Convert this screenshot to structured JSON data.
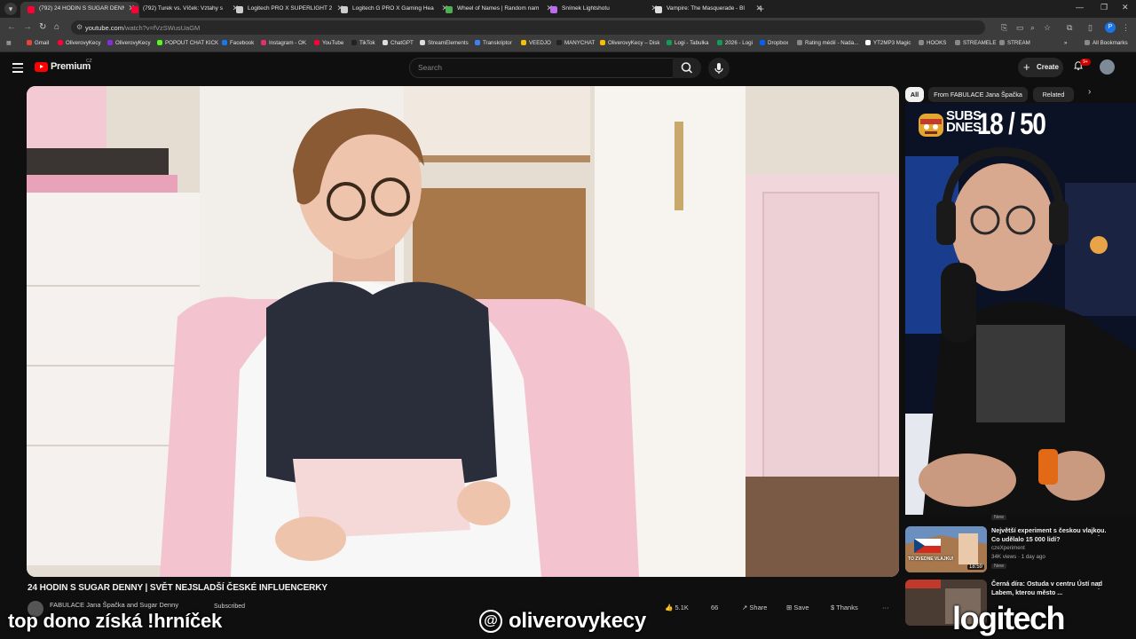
{
  "browser": {
    "tabs": [
      {
        "title": "(792) 24 HODIN S SUGAR DENNY",
        "active": true,
        "favicon_color": "#ff0033"
      },
      {
        "title": "(792) Turek vs. Víček: Vztahy s",
        "active": false,
        "favicon_color": "#ff0033"
      },
      {
        "title": "Logitech PRO X SUPERLIGHT 2",
        "active": false,
        "favicon_color": "#cccccc"
      },
      {
        "title": "Logitech G PRO X Gaming Hea",
        "active": false,
        "favicon_color": "#cccccc"
      },
      {
        "title": "Wheel of Names | Random nam",
        "active": false,
        "favicon_color": "#4caf50"
      },
      {
        "title": "Snímek Lightshotu",
        "active": false,
        "favicon_color": "#b96cf0"
      },
      {
        "title": "Vampire: The Masquerade - Bl",
        "active": false,
        "favicon_color": "#dddddd"
      }
    ],
    "url_host": "youtube.com",
    "url_path": "/watch?v=fVzSWusUaGM",
    "profile_initial": "P",
    "bookmarks": [
      {
        "label": "Gmail",
        "color": "#ea4335"
      },
      {
        "label": "OliverovyKecy",
        "color": "#ff0033"
      },
      {
        "label": "OliverovyKecy",
        "color": "#8a2be2"
      },
      {
        "label": "POPOUT CHAT KICK",
        "color": "#53fc18"
      },
      {
        "label": "Facebook",
        "color": "#1877f2"
      },
      {
        "label": "Instagram - OK",
        "color": "#e1306c"
      },
      {
        "label": "YouTube",
        "color": "#ff0033"
      },
      {
        "label": "TikTok",
        "color": "#222222"
      },
      {
        "label": "ChatGPT",
        "color": "#dddddd"
      },
      {
        "label": "StreamElements",
        "color": "#dddddd"
      },
      {
        "label": "Transkriptor",
        "color": "#3b82f6"
      },
      {
        "label": "VEEDJO",
        "color": "#f5c400"
      },
      {
        "label": "MANYCHAT",
        "color": "#222222"
      },
      {
        "label": "OliverovyKecy – Disk",
        "color": "#fbbc04"
      },
      {
        "label": "Logi - Tabulka",
        "color": "#0f9d58"
      },
      {
        "label": "2026 - Logi",
        "color": "#0f9d58"
      },
      {
        "label": "Dropbox",
        "color": "#0061ff"
      },
      {
        "label": "Rating médií - Nada...",
        "color": "#888888"
      },
      {
        "label": "YT2MP3 Magic",
        "color": "#ffffff"
      },
      {
        "label": "HOOKS",
        "color": "#888888"
      },
      {
        "label": "STREAMELE",
        "color": "#888888"
      },
      {
        "label": "STREAM",
        "color": "#888888"
      }
    ],
    "all_bookmarks_label": "All Bookmarks"
  },
  "youtube": {
    "logo_text": "Premium",
    "country_code": "CZ",
    "search_placeholder": "Search",
    "create_label": "Create",
    "notification_count": "9+",
    "video_title": "24 HODIN S SUGAR DENNY | SVĚT NEJSLADŠÍ ČESKÉ INFLUENCERKY",
    "channel_name": "FABULACE Jana Špačka and Sugar Denny",
    "subscribed_label": "Subscribed",
    "like_count": "5.1K",
    "dislike_count": "66",
    "share_label": "Share",
    "save_label": "Save",
    "thanks_label": "Thanks",
    "more_label": "···",
    "chips": [
      "All",
      "From FABULACE Jana Špačka",
      "Related"
    ],
    "new_label": "New",
    "recommendations": [
      {
        "title": "Největší experiment s českou vlajkou. Co udělalo 15 000 lidí?",
        "channel": "czeXperiment",
        "meta": "34K views · 1 day ago",
        "badge": "New",
        "duration": "18:59",
        "thumb_text": "TO ZVEDNE VLAJKU!"
      },
      {
        "title": "Černá díra: Ostuda v centru Ústí nad Labem, kterou město ...",
        "channel": "",
        "meta": "",
        "badge": "",
        "duration": "",
        "thumb_text": ""
      }
    ]
  },
  "stream_overlay": {
    "subs_label_line1": "SUBS",
    "subs_label_line2": "DNES",
    "subs_count": "18 / 50",
    "promo_text": "top dono získá !hrníček",
    "social_handle": "oliverovykecy",
    "sponsor": "logitech"
  }
}
